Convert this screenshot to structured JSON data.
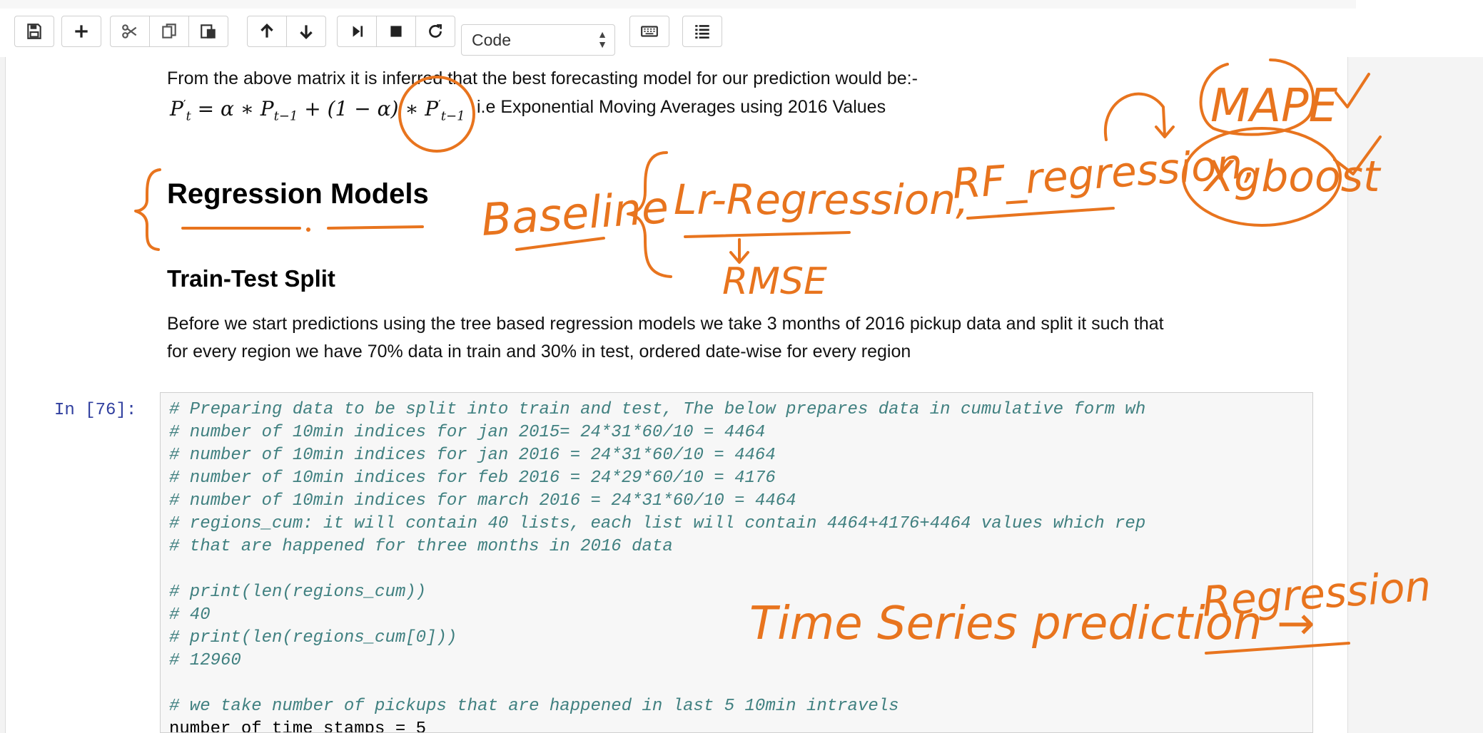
{
  "toolbar": {
    "buttons": [
      {
        "name": "save",
        "icon": "save-icon"
      },
      {
        "name": "insert-cell",
        "icon": "plus-icon"
      },
      {
        "name": "cut",
        "icon": "scissors-icon"
      },
      {
        "name": "copy",
        "icon": "copy-icon"
      },
      {
        "name": "paste",
        "icon": "paste-icon"
      },
      {
        "name": "move-up",
        "icon": "arrow-up-icon"
      },
      {
        "name": "move-down",
        "icon": "arrow-down-icon"
      },
      {
        "name": "run",
        "icon": "step-forward-icon"
      },
      {
        "name": "interrupt",
        "icon": "stop-icon"
      },
      {
        "name": "restart",
        "icon": "refresh-icon"
      },
      {
        "name": "command-palette",
        "icon": "keyboard-icon"
      },
      {
        "name": "cell-toolbar",
        "icon": "list-icon"
      }
    ],
    "cell_type": "Code"
  },
  "markdown": {
    "inference_text": "From the above matrix it is inferred that the best forecasting model for our prediction would be:-",
    "formula": "P′t = α ∗ Pt−1 + (1 − α) ∗ P′t−1",
    "formula_parts": {
      "lhs": "P",
      "lhs_sub": "t",
      "eq1": " = α ∗ P",
      "sub1": "t−1",
      "eq2": " + (1 − α) ∗ P",
      "sub2": "t−1"
    },
    "formula_note": "i.e Exponential Moving Averages using 2016 Values",
    "heading_regression": "Regression Models",
    "heading_split": "Train-Test Split",
    "para_line1": "Before we start predictions using the tree based regression models we take 3 months of 2016 pickup data and split it such that",
    "para_line2": "for every region we have 70% data in train and 30% in test, ordered date-wise for every region"
  },
  "code_cell": {
    "prompt": "In [76]:",
    "lines": [
      "# Preparing data to be split into train and test, The below prepares data in cumulative form wh",
      "# number of 10min indices for jan 2015= 24*31*60/10 = 4464",
      "# number of 10min indices for jan 2016 = 24*31*60/10 = 4464",
      "# number of 10min indices for feb 2016 = 24*29*60/10 = 4176",
      "# number of 10min indices for march 2016 = 24*31*60/10 = 4464",
      "# regions_cum: it will contain 40 lists, each list will contain 4464+4176+4464 values which rep",
      "# that are happened for three months in 2016 data",
      "",
      "# print(len(regions_cum))",
      "# 40",
      "# print(len(regions_cum[0]))",
      "# 12960",
      "",
      "# we take number of pickups that are happened in last 5 10min intravels",
      "number of time stamps = 5"
    ]
  },
  "annotations": {
    "mape": "MAPE",
    "xgboost": "Xgboost",
    "baseline": "Baseline",
    "lr": "Lr-Regression,",
    "rf": "RF_regression,",
    "rmse": "RMSE",
    "timeseries": "Time Series prediction →",
    "regression": "Regression",
    "ink_color": "#e8741e"
  }
}
